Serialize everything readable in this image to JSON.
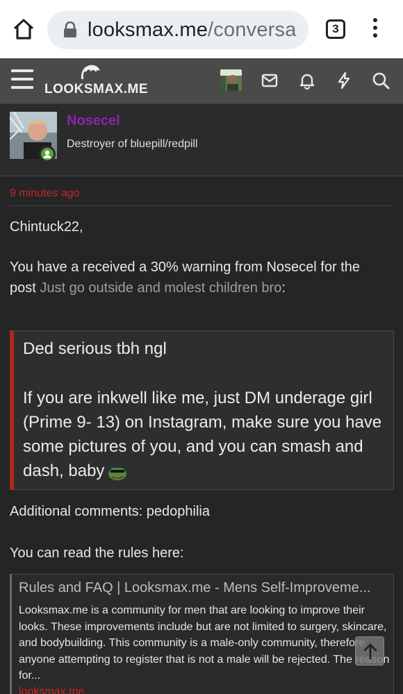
{
  "browser": {
    "url_host": "looksmax.me",
    "url_path": "/conversa",
    "tab_count": "3"
  },
  "site": {
    "logo_text": "LOOKSMAX.ME"
  },
  "member": {
    "name": "Nosecel",
    "title": "Destroyer of bluepill/redpill",
    "online": true
  },
  "message": {
    "timestamp": "9 minutes ago",
    "greeting": "Chintuck22,",
    "warning_line1": "You have a received a 30% warning from Nosecel for the",
    "warning_post_prefix": "post ",
    "warning_post_link": "Just go outside and molest children bro",
    "warning_post_suffix": ":",
    "quote_p1": "Ded serious tbh ngl",
    "quote_p2": "If you are inkwell like me, just DM underage girl (Prime 9- 13) on Instagram, make sure you have some pictures of you, and you can smash and dash, baby",
    "additional_comments": "Additional comments: pedophilia",
    "rules_line": "You can read the rules here:"
  },
  "unfurl": {
    "title": "Rules and FAQ | Looksmax.me - Mens Self-Improveme...",
    "description": "Looksmax.me is a community for men that are looking to improve their looks. These improvements include but are not limited to surgery, skincare, and bodybuilding. This community is a male-only community, therefore anyone attempting to register that is not a male will be rejected. The reason for...",
    "domain": "looksmax.me"
  },
  "colors": {
    "accent_red": "#c62828",
    "username_purple": "#8e24aa",
    "online_green": "#54a33a"
  }
}
